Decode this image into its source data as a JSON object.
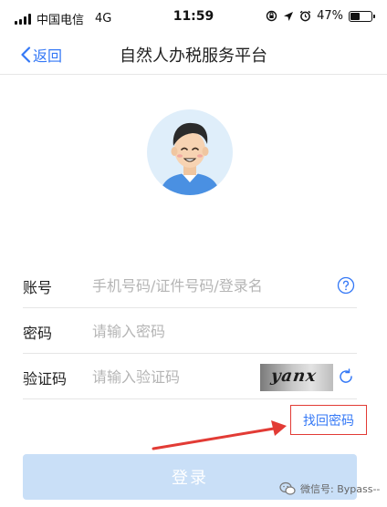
{
  "status_bar": {
    "carrier": "中国电信",
    "network": "4G",
    "time": "11:59",
    "battery_pct": "47%",
    "battery_level": 0.47
  },
  "nav": {
    "back_label": "返回",
    "title": "自然人办税服务平台"
  },
  "form": {
    "account": {
      "label": "账号",
      "placeholder": "手机号码/证件号码/登录名"
    },
    "password": {
      "label": "密码",
      "placeholder": "请输入密码"
    },
    "captcha": {
      "label": "验证码",
      "placeholder": "请输入验证码",
      "captcha_text": "yanx"
    }
  },
  "forgot_password": "找回密码",
  "login_button": "登录",
  "watermark": "微信号: Bypass--",
  "colors": {
    "accent": "#3478f6",
    "login_disabled": "#c9dff7",
    "highlight": "#e23b35"
  }
}
